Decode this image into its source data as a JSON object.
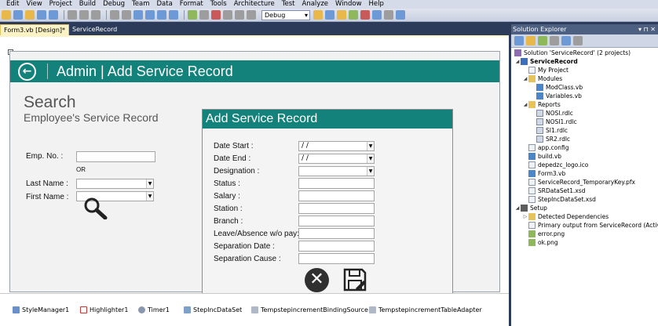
{
  "menu": [
    "Edit",
    "View",
    "Project",
    "Build",
    "Debug",
    "Team",
    "Data",
    "Format",
    "Tools",
    "Architecture",
    "Test",
    "Analyze",
    "Window",
    "Help"
  ],
  "toolbar": {
    "config": "Debug"
  },
  "tabs": [
    {
      "label": "Form3.vb [Design]*",
      "active": true
    },
    {
      "label": "ServiceRecord",
      "active": false
    }
  ],
  "form": {
    "header_title": "Admin | Add Service Record",
    "search_title": "Search",
    "search_subtitle": "Employee's Service Record",
    "emp_no_label": "Emp. No. :",
    "or_label": "OR",
    "last_name_label": "Last Name :",
    "first_name_label": "First Name :",
    "panel_title": "Add Service Record",
    "fields": [
      {
        "label": "Date Start :",
        "value": " /  /"
      },
      {
        "label": "Date End :",
        "value": " /  /"
      },
      {
        "label": "Designation :",
        "value": ""
      },
      {
        "label": "Status :",
        "value": ""
      },
      {
        "label": "Salary :",
        "value": ""
      },
      {
        "label": "Station :",
        "value": ""
      },
      {
        "label": "Branch :",
        "value": ""
      },
      {
        "label": "Leave/Absence w/o pay:",
        "value": ""
      },
      {
        "label": "Separation Date :",
        "value": ""
      },
      {
        "label": "Separation Cause :",
        "value": ""
      }
    ]
  },
  "tray": [
    "StyleManager1",
    "Highlighter1",
    "Timer1",
    "StepIncDataSet",
    "TempstepincrementBindingSource",
    "TempstepincrementTableAdapter"
  ],
  "solution_explorer": {
    "title": "Solution Explorer",
    "solution": "Solution 'ServiceRecord' (2 projects)",
    "project": "ServiceRecord",
    "my_project": "My Project",
    "modules": "Modules",
    "module_items": [
      "ModClass.vb",
      "Variables.vb"
    ],
    "reports": "Reports",
    "report_items": [
      "NOSI.rdlc",
      "NOSI1.rdlc",
      "SI1.rdlc",
      "SR2.rdlc"
    ],
    "files": [
      "app.config",
      "build.vb",
      "depedzc_logo.ico",
      "Form3.vb",
      "ServiceRecord_TemporaryKey.pfx",
      "SRDataSet1.xsd",
      "StepIncDataSet.xsd"
    ],
    "setup": "Setup",
    "setup_items": [
      "Detected Dependencies",
      "Primary output from ServiceRecord (Active)",
      "error.png",
      "ok.png"
    ]
  }
}
